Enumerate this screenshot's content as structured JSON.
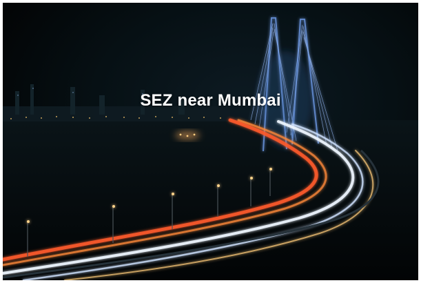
{
  "hero": {
    "title": "SEZ near Mumbai",
    "image_subject": "night-highway-bridge-light-trails",
    "colors": {
      "sky": "#050809",
      "light_trail_red": "#ff5a2a",
      "light_trail_white": "#eef6ff",
      "bridge_glow": "#7fb2ff",
      "city_lights": "#f5c36a"
    }
  }
}
